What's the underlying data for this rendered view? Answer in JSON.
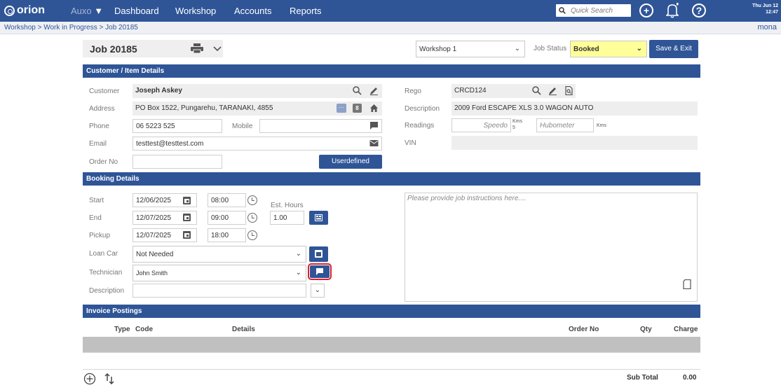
{
  "app": {
    "logo": "orion",
    "nav": [
      "Auxo",
      "Dashboard",
      "Workshop",
      "Accounts",
      "Reports"
    ],
    "search_placeholder": "Quick Search",
    "date_line1": "Thu Jun 12",
    "date_line2": "12:47",
    "user": "mona",
    "breadcrumb": "Workshop > Work in Progress > Job 20185"
  },
  "job": {
    "title": "Job 20185",
    "workshop": "Workshop 1",
    "status_label": "Job Status",
    "status_value": "Booked",
    "save_exit": "Save & Exit"
  },
  "customer_section": {
    "heading": "Customer / Item Details",
    "customer_label": "Customer",
    "customer_value": "Joseph Askey",
    "address_label": "Address",
    "address_value": "PO Box 1522, Pungarehu, TARANAKI, 4855",
    "phone_label": "Phone",
    "phone_value": "06 5223 525",
    "mobile_label": "Mobile",
    "mobile_value": "",
    "email_label": "Email",
    "email_value": "testtest@testtest.com",
    "orderno_label": "Order No",
    "orderno_value": "",
    "userdefined_button": "Userdefined",
    "rego_label": "Rego",
    "rego_value": "CRCD124",
    "description_label": "Description",
    "description_value": "2009 Ford ESCAPE XLS 3.0 WAGON AUTO",
    "readings_label": "Readings",
    "speedo_placeholder": "Speedo",
    "speedo_unit": "Kms",
    "speedo_sub": "5",
    "hubometer_placeholder": "Hubometer",
    "hubometer_unit": "Kms",
    "vin_label": "VIN",
    "vin_value": ""
  },
  "booking_section": {
    "heading": "Booking Details",
    "start_label": "Start",
    "start_date": "12/06/2025",
    "start_time": "08:00",
    "end_label": "End",
    "end_date": "12/07/2025",
    "end_time": "09:00",
    "pickup_label": "Pickup",
    "pickup_date": "12/07/2025",
    "pickup_time": "18:00",
    "est_hours_label": "Est. Hours",
    "est_hours_value": "1.00",
    "loancar_label": "Loan Car",
    "loancar_value": "Not Needed",
    "technician_label": "Technician",
    "technician_value": "John Smith",
    "description_label": "Description",
    "description_value": "",
    "instructions_placeholder": "Please provide job instructions here...."
  },
  "invoice_section": {
    "heading": "Invoice Postings",
    "columns": [
      "Type",
      "Code",
      "Details",
      "Order No",
      "Qty",
      "Charge"
    ],
    "subtotal_label": "Sub Total",
    "subtotal_value": "0.00"
  },
  "colors": {
    "brand": "#2f5597",
    "status_highlight": "#ffff99",
    "highlight_ring": "#d9202f"
  }
}
